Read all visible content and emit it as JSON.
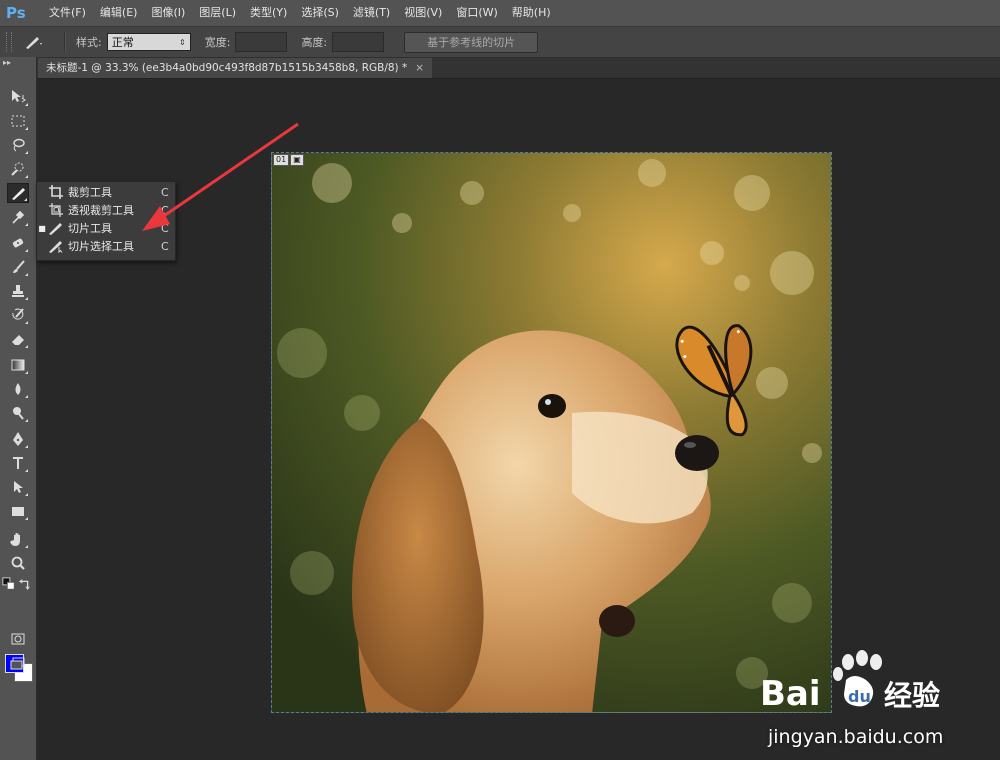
{
  "app": {
    "logo": "Ps"
  },
  "menu": {
    "items": [
      "文件(F)",
      "编辑(E)",
      "图像(I)",
      "图层(L)",
      "类型(Y)",
      "选择(S)",
      "滤镜(T)",
      "视图(V)",
      "窗口(W)",
      "帮助(H)"
    ]
  },
  "options": {
    "style_label": "样式:",
    "style_value": "正常",
    "width_label": "宽度:",
    "height_label": "高度:",
    "guides_button": "基于参考线的切片"
  },
  "document": {
    "tab_title": "未标题-1 @ 33.3% (ee3b4a0bd90c493f8d87b1515b3458b8, RGB/8) *",
    "close": "×",
    "slice_number": "01"
  },
  "flyout": {
    "items": [
      {
        "label": "裁剪工具",
        "shortcut": "C",
        "icon": "crop-icon"
      },
      {
        "label": "透视裁剪工具",
        "shortcut": "C",
        "icon": "perspective-crop-icon"
      },
      {
        "label": "切片工具",
        "shortcut": "C",
        "icon": "slice-icon",
        "selected": "■"
      },
      {
        "label": "切片选择工具",
        "shortcut": "C",
        "icon": "slice-select-icon"
      }
    ]
  },
  "colors": {
    "foreground": "#0000ff",
    "background": "#ffffff",
    "annotation_arrow": "#e8383d",
    "logo": "#5fb0f0"
  },
  "watermark": {
    "text": "jingyan.baidu.com",
    "brand": "Bai",
    "brand2": "经验"
  }
}
